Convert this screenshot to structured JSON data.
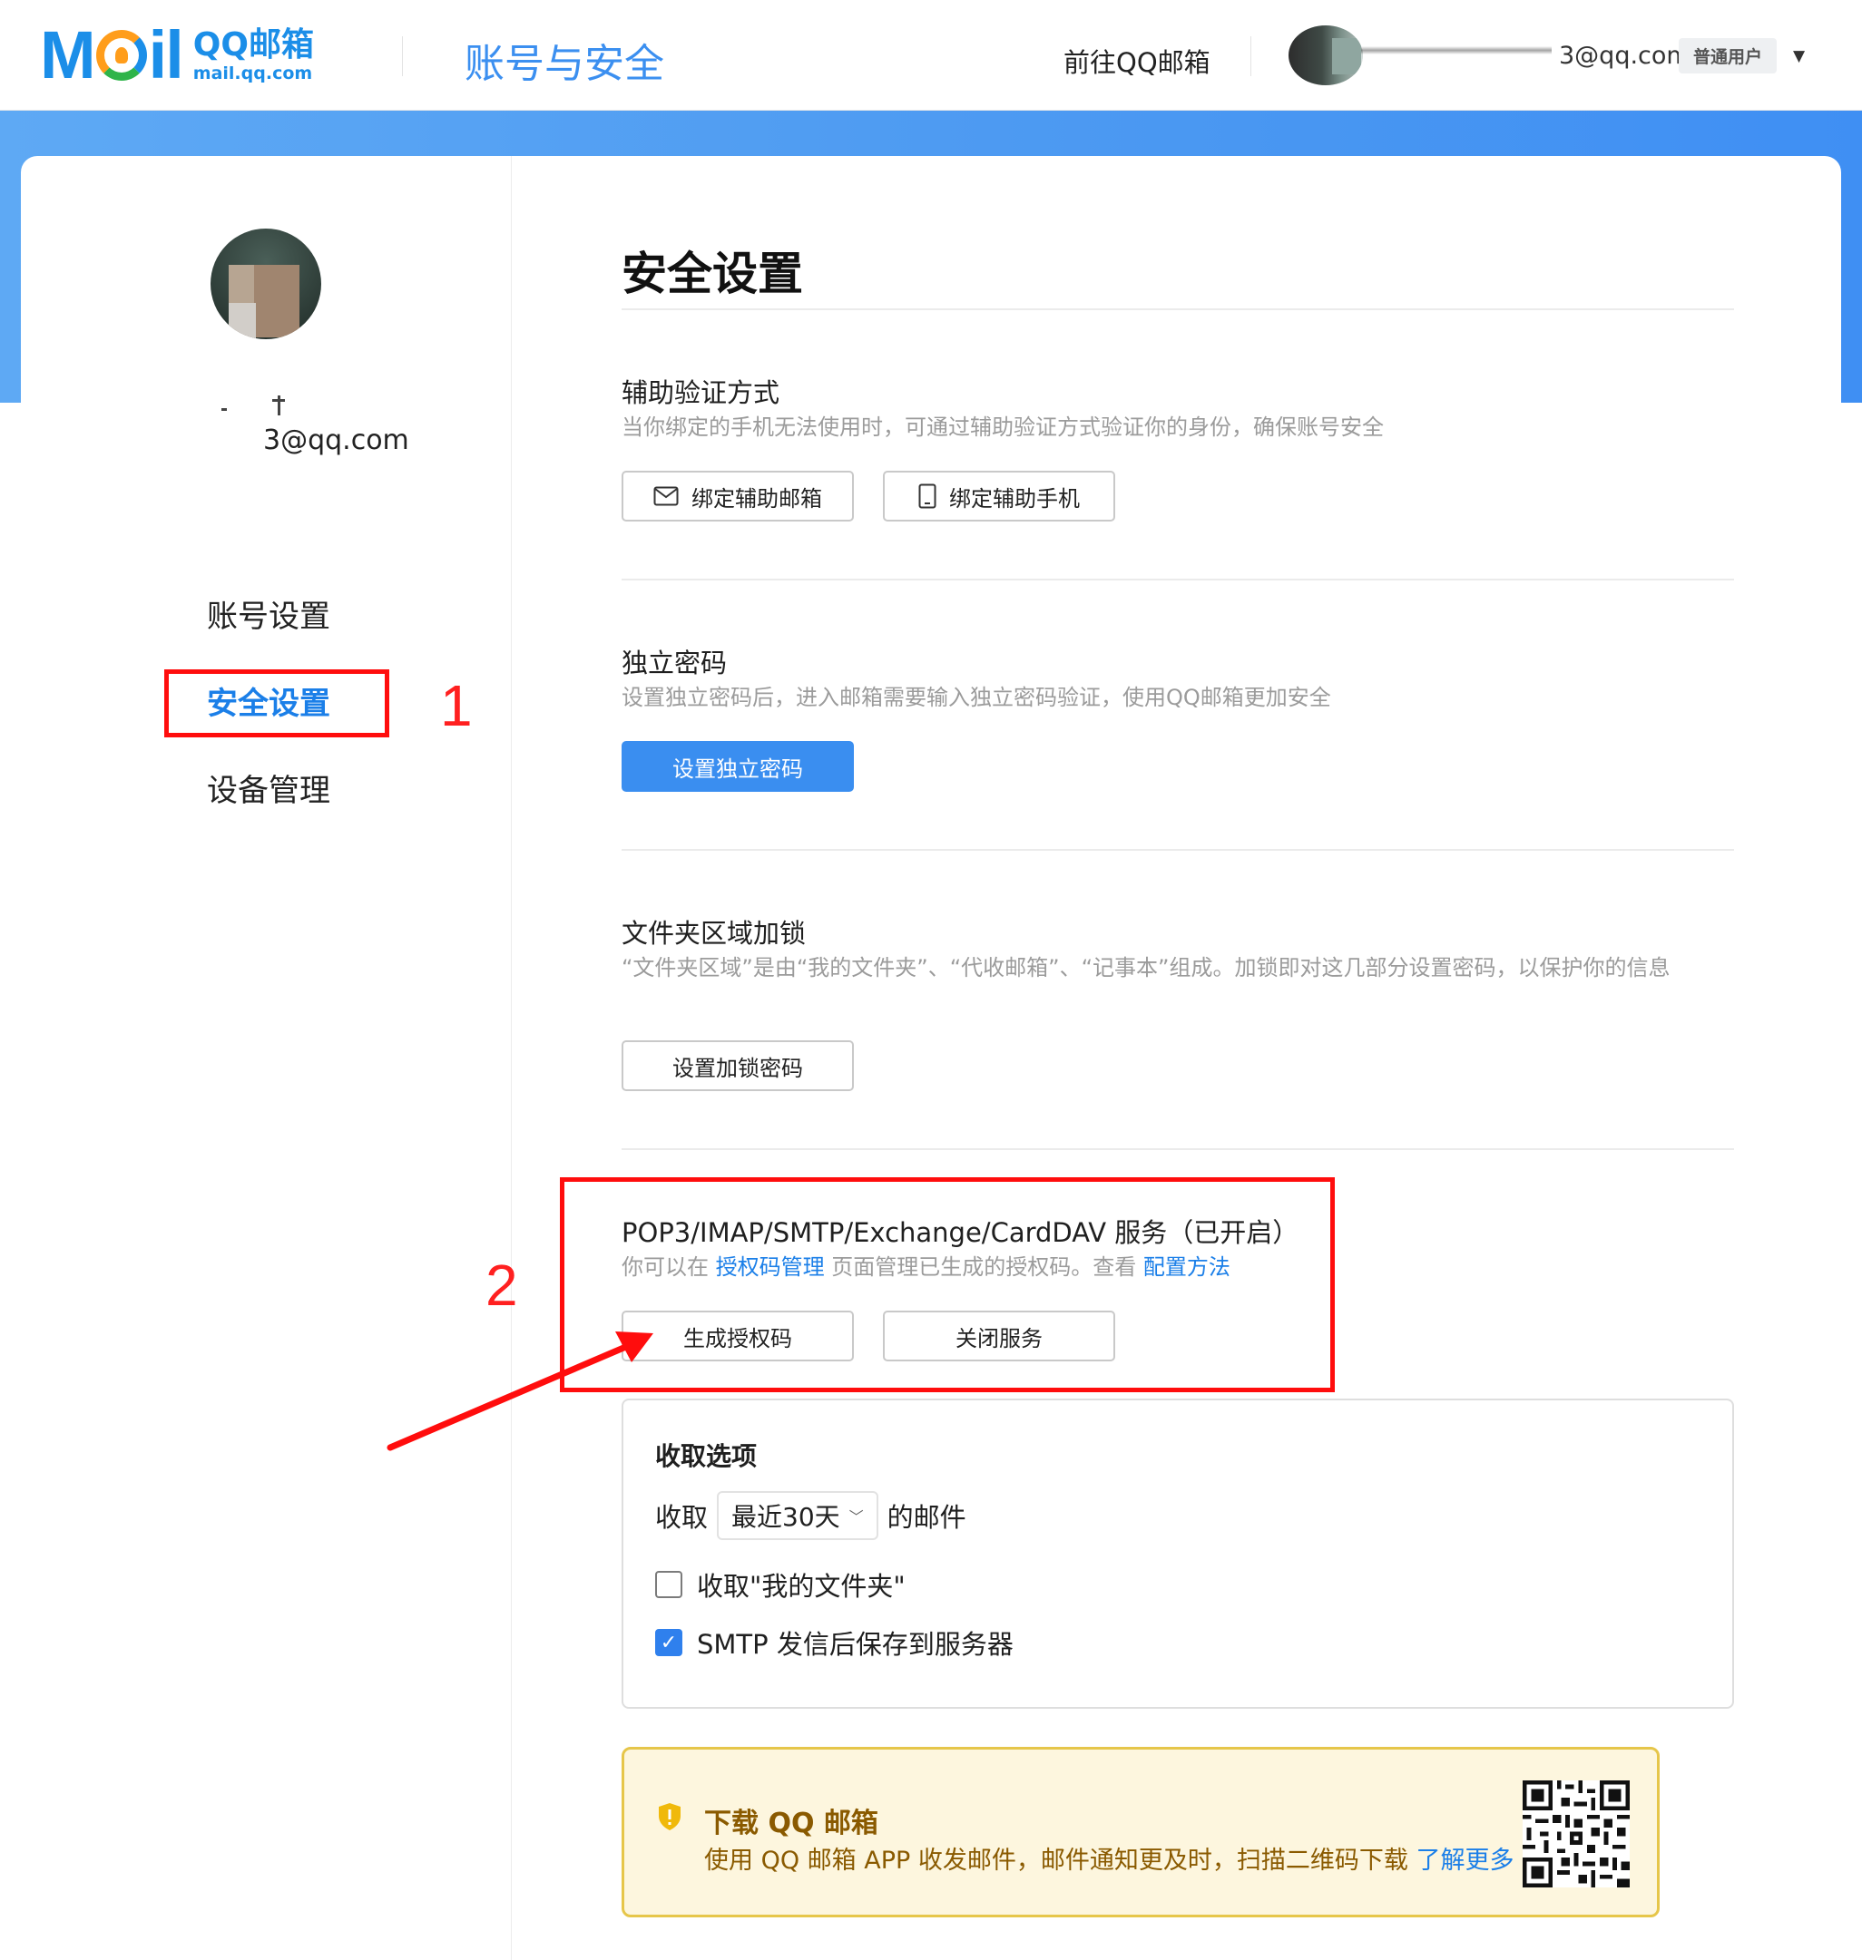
{
  "header": {
    "logo_mark": "Mil",
    "logo_cn": "QQ邮箱",
    "logo_domain": "mail.qq.com",
    "page_heading": "账号与安全",
    "goto_link": "前往QQ邮箱",
    "user_email": "3@qq.com",
    "user_badge": "普通用户",
    "caret": "▼"
  },
  "sidebar": {
    "email": "3@qq.com",
    "items": [
      {
        "label": "账号设置"
      },
      {
        "label": "安全设置"
      },
      {
        "label": "设备管理"
      }
    ]
  },
  "main": {
    "title": "安全设置",
    "aux_verify": {
      "title": "辅助验证方式",
      "desc": "当你绑定的手机无法使用时，可通过辅助验证方式验证你的身份，确保账号安全",
      "bind_email": "绑定辅助邮箱",
      "bind_phone": "绑定辅助手机"
    },
    "independent_pwd": {
      "title": "独立密码",
      "desc": "设置独立密码后，进入邮箱需要输入独立密码验证，使用QQ邮箱更加安全",
      "button": "设置独立密码"
    },
    "folder_lock": {
      "title": "文件夹区域加锁",
      "desc": "“文件夹区域”是由“我的文件夹”、“代收邮箱”、“记事本”组成。加锁即对这几部分设置密码，以保护你的信息",
      "button": "设置加锁密码"
    },
    "service": {
      "title": "POP3/IMAP/SMTP/Exchange/CardDAV 服务（已开启）",
      "desc_prefix": "你可以在",
      "desc_link1": "授权码管理",
      "desc_mid": "页面管理已生成的授权码。查看",
      "desc_link2": "配置方法",
      "gen_button": "生成授权码",
      "close_button": "关闭服务"
    },
    "options": {
      "title": "收取选项",
      "receive_prefix": "收取",
      "receive_select": "最近30天",
      "receive_suffix": "的邮件",
      "my_folders": "收取\"我的文件夹\"",
      "my_folders_checked": false,
      "smtp_save": "SMTP 发信后保存到服务器",
      "smtp_save_checked": true
    },
    "download": {
      "title": "下载 QQ 邮箱",
      "desc": "使用 QQ 邮箱 APP 收发邮件，邮件通知更及时，扫描二维码下载",
      "link": "了解更多"
    }
  },
  "annotations": {
    "step1": "1",
    "step2": "2",
    "color": "#ff0d0d"
  },
  "colors": {
    "accent": "#3a8ef0",
    "link": "#1b7fe8",
    "band": "#4e9bf2",
    "banner_bg": "#fdf6de",
    "banner_border": "#e6c64a"
  }
}
